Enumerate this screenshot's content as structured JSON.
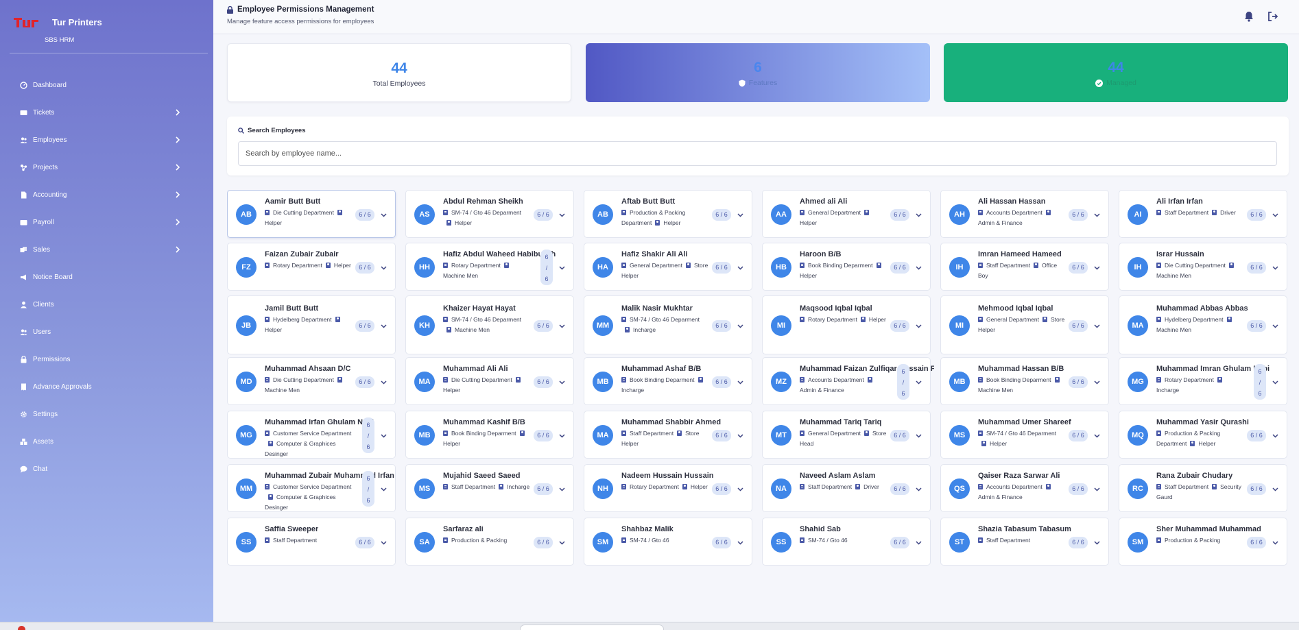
{
  "brand": {
    "name": "Tur Printers",
    "subtitle": "SBS HRM",
    "logo_text": "tur",
    "logo_color": "#e0232a"
  },
  "sidebar": {
    "items": [
      {
        "label": "Dashboard",
        "icon": "speedometer-icon",
        "has_submenu": false
      },
      {
        "label": "Tickets",
        "icon": "ticket-icon",
        "has_submenu": true
      },
      {
        "label": "Employees",
        "icon": "users-icon",
        "has_submenu": true
      },
      {
        "label": "Projects",
        "icon": "project-icon",
        "has_submenu": true
      },
      {
        "label": "Accounting",
        "icon": "document-icon",
        "has_submenu": true
      },
      {
        "label": "Payroll",
        "icon": "wallet-icon",
        "has_submenu": true
      },
      {
        "label": "Sales",
        "icon": "cart-icon",
        "has_submenu": true
      },
      {
        "label": "Notice Board",
        "icon": "megaphone-icon",
        "has_submenu": false
      },
      {
        "label": "Clients",
        "icon": "user-icon",
        "has_submenu": false
      },
      {
        "label": "Users",
        "icon": "users-icon",
        "has_submenu": false
      },
      {
        "label": "Permissions",
        "icon": "lock-icon",
        "has_submenu": false
      },
      {
        "label": "Advance Approvals",
        "icon": "invoice-icon",
        "has_submenu": false
      },
      {
        "label": "Settings",
        "icon": "gear-icon",
        "has_submenu": false
      },
      {
        "label": "Assets",
        "icon": "boxes-icon",
        "has_submenu": false
      },
      {
        "label": "Chat",
        "icon": "chat-icon",
        "has_submenu": false
      }
    ]
  },
  "header": {
    "title": "Employee Permissions Management",
    "subtitle": "Manage feature access permissions for employees"
  },
  "stats": [
    {
      "value": "44",
      "label": "Total Employees",
      "icon": ""
    },
    {
      "value": "6",
      "label": "Features",
      "icon": "shield-icon"
    },
    {
      "value": "44",
      "label": "Managed",
      "icon": "check-circle-icon"
    }
  ],
  "search": {
    "title": "Search Employees",
    "placeholder": "Search by employee name..."
  },
  "employees": [
    {
      "initials": "AB",
      "name": "Aamir Butt Butt",
      "dept": "Die Cutting Department",
      "role": "Helper",
      "perm": "6 / 6"
    },
    {
      "initials": "AS",
      "name": "Abdul Rehman Sheikh",
      "dept": "SM-74 / Gto 46 Deparment",
      "role": "Helper",
      "perm": "6 / 6"
    },
    {
      "initials": "AB",
      "name": "Aftab Butt Butt",
      "dept": "Production & Packing Department",
      "role": "Helper",
      "perm": "6 / 6"
    },
    {
      "initials": "AA",
      "name": "Ahmed ali Ali",
      "dept": "General Department",
      "role": "Helper",
      "perm": "6 / 6"
    },
    {
      "initials": "AH",
      "name": "Ali Hassan Hassan",
      "dept": "Accounts Department",
      "role": "Admin & Finance",
      "perm": "6 / 6"
    },
    {
      "initials": "AI",
      "name": "Ali Irfan Irfan",
      "dept": "Staff Department",
      "role": "Driver",
      "perm": "6 / 6"
    },
    {
      "initials": "FZ",
      "name": "Faizan Zubair Zubair",
      "dept": "Rotary Department",
      "role": "Helper",
      "perm": "6 / 6"
    },
    {
      "initials": "HH",
      "name": "Hafiz Abdul Waheed Habibullah",
      "dept": "Rotary Department",
      "role": "Machine Men",
      "perm": "6 / 6"
    },
    {
      "initials": "HA",
      "name": "Hafiz Shakir Ali Ali",
      "dept": "General Department",
      "role": "Store Helper",
      "perm": "6 / 6"
    },
    {
      "initials": "HB",
      "name": "Haroon B/B",
      "dept": "Book Binding Deparment",
      "role": "Helper",
      "perm": "6 / 6"
    },
    {
      "initials": "IH",
      "name": "Imran Hameed Hameed",
      "dept": "Staff Department",
      "role": "Office Boy",
      "perm": "6 / 6"
    },
    {
      "initials": "IH",
      "name": "Israr Hussain",
      "dept": "Die Cutting Department",
      "role": "Machine Men",
      "perm": "6 / 6"
    },
    {
      "initials": "JB",
      "name": "Jamil Butt Butt",
      "dept": "Hydelberg Department",
      "role": "Helper",
      "perm": "6 / 6"
    },
    {
      "initials": "KH",
      "name": "Khaizer Hayat Hayat",
      "dept": "SM-74 / Gto 46 Deparment",
      "role": "Machine Men",
      "perm": "6 / 6"
    },
    {
      "initials": "MM",
      "name": "Malik Nasir Mukhtar",
      "dept": "SM-74 / Gto 46 Deparment",
      "role": "Incharge",
      "perm": "6 / 6"
    },
    {
      "initials": "MI",
      "name": "Maqsood Iqbal Iqbal",
      "dept": "Rotary Department",
      "role": "Helper",
      "perm": "6 / 6"
    },
    {
      "initials": "MI",
      "name": "Mehmood Iqbal Iqbal",
      "dept": "General Department",
      "role": "Store Helper",
      "perm": "6 / 6"
    },
    {
      "initials": "MA",
      "name": "Muhammad Abbas Abbas",
      "dept": "Hydelberg Department",
      "role": "Machine Men",
      "perm": "6 / 6"
    },
    {
      "initials": "MD",
      "name": "Muhammad Ahsaan D/C",
      "dept": "Die Cutting Department",
      "role": "Machine Men",
      "perm": "6 / 6"
    },
    {
      "initials": "MA",
      "name": "Muhammad Ali Ali",
      "dept": "Die Cutting Department",
      "role": "Helper",
      "perm": "6 / 6"
    },
    {
      "initials": "MB",
      "name": "Muhammad Ashaf B/B",
      "dept": "Book Binding Deparment",
      "role": "Incharge",
      "perm": "6 / 6"
    },
    {
      "initials": "MZ",
      "name": "Muhammad Faizan Zulfiqar Hussain F",
      "dept": "Accounts Department",
      "role": "Admin & Finance",
      "perm": "6 / 6"
    },
    {
      "initials": "MB",
      "name": "Muhammad Hassan B/B",
      "dept": "Book Binding Deparment",
      "role": "Machine Men",
      "perm": "6 / 6"
    },
    {
      "initials": "MG",
      "name": "Muhammad Imran Ghulam Nabi",
      "dept": "Rotary Department",
      "role": "Incharge",
      "perm": "6 / 6"
    },
    {
      "initials": "MG",
      "name": "Muhammad Irfan Ghulam Nabi",
      "dept": "Customer Service Department",
      "role": "Computer & Graphices Desinger",
      "perm": "6 / 6"
    },
    {
      "initials": "MB",
      "name": "Muhammad Kashif B/B",
      "dept": "Book Binding Deparment",
      "role": "Helper",
      "perm": "6 / 6"
    },
    {
      "initials": "MA",
      "name": "Muhammad Shabbir Ahmed",
      "dept": "Staff Department",
      "role": "Store Helper",
      "perm": "6 / 6"
    },
    {
      "initials": "MT",
      "name": "Muhammad Tariq Tariq",
      "dept": "General Department",
      "role": "Store Head",
      "perm": "6 / 6"
    },
    {
      "initials": "MS",
      "name": "Muhammad Umer Shareef",
      "dept": "SM-74 / Gto 46 Deparment",
      "role": "Helper",
      "perm": "6 / 6"
    },
    {
      "initials": "MQ",
      "name": "Muhammad Yasir Qurashi",
      "dept": "Production & Packing Department",
      "role": "Helper",
      "perm": "6 / 6"
    },
    {
      "initials": "MM",
      "name": "Muhammad Zubair Muhammad Irfan",
      "dept": "Customer Service Department",
      "role": "Computer & Graphices Desinger",
      "perm": "6 / 6"
    },
    {
      "initials": "MS",
      "name": "Mujahid Saeed Saeed",
      "dept": "Staff Department",
      "role": "Incharge",
      "perm": "6 / 6"
    },
    {
      "initials": "NH",
      "name": "Nadeem Hussain Hussain",
      "dept": "Rotary Department",
      "role": "Helper",
      "perm": "6 / 6"
    },
    {
      "initials": "NA",
      "name": "Naveed Aslam Aslam",
      "dept": "Staff Department",
      "role": "Driver",
      "perm": "6 / 6"
    },
    {
      "initials": "QS",
      "name": "Qaiser Raza Sarwar Ali",
      "dept": "Accounts Department",
      "role": "Admin & Finance",
      "perm": "6 / 6"
    },
    {
      "initials": "RC",
      "name": "Rana Zubair Chudary",
      "dept": "Staff Department",
      "role": "Security Gaurd",
      "perm": "6 / 6"
    },
    {
      "initials": "SS",
      "name": "Saffia Sweeper",
      "dept": "Staff Department",
      "role": "",
      "perm": "6 / 6"
    },
    {
      "initials": "SA",
      "name": "Sarfaraz ali",
      "dept": "Production & Packing",
      "role": "",
      "perm": "6 / 6"
    },
    {
      "initials": "SM",
      "name": "Shahbaz Malik",
      "dept": "SM-74 / Gto 46",
      "role": "",
      "perm": "6 / 6"
    },
    {
      "initials": "SS",
      "name": "Shahid Sab",
      "dept": "SM-74 / Gto 46",
      "role": "",
      "perm": "6 / 6"
    },
    {
      "initials": "ST",
      "name": "Shazia Tabasum Tabasum",
      "dept": "Staff Department",
      "role": "",
      "perm": "6 / 6"
    },
    {
      "initials": "SM",
      "name": "Sher Muhammad Muhammad",
      "dept": "Production & Packing",
      "role": "",
      "perm": "6 / 6"
    }
  ],
  "colors": {
    "accent": "#4b5aa8",
    "avatar": "#3f86e8",
    "features_gradient": [
      "#5158c4",
      "#a4c0f8"
    ],
    "managed_green": "#18b07c"
  }
}
